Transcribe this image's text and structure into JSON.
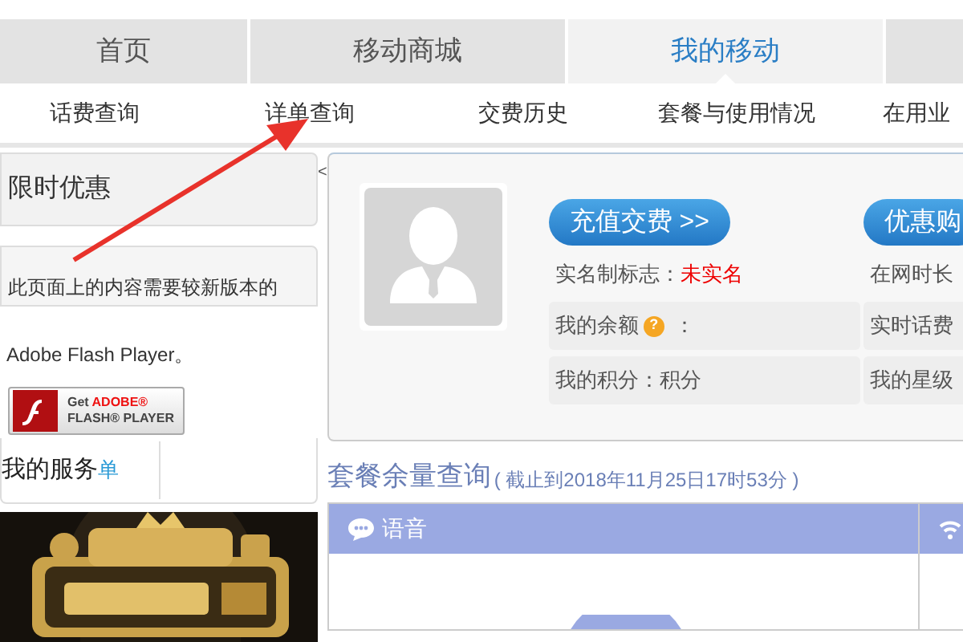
{
  "tabs": [
    {
      "label": "首页",
      "selected": false
    },
    {
      "label": "移动商城",
      "selected": false
    },
    {
      "label": "我的移动",
      "selected": true
    },
    {
      "selected": false
    }
  ],
  "subnav": [
    "话费查询",
    "详单查询",
    "交费历史",
    "套餐与使用情况",
    "在用业"
  ],
  "sidebar": {
    "promo_title": "限时优惠",
    "flash_notice": "此页面上的内容需要较新版本的",
    "flash_name": "Adobe Flash Player。",
    "flash_button": {
      "line1_prefix": "Get ",
      "line1_brand": "ADOBE®",
      "line2": "FLASH® PLAYER"
    },
    "service_title": "我的服务",
    "service_overlap": "单",
    "collapse": "<"
  },
  "account": {
    "buttons": [
      "充值交费 >>",
      "优惠购"
    ],
    "left": [
      {
        "kind": "plain",
        "label": "实名制标志：",
        "value": "未实名"
      },
      {
        "kind": "help",
        "label": "我的余额",
        "help_mark": "?",
        "value": "："
      },
      {
        "kind": "shaded",
        "label": "我的积分：积分"
      }
    ],
    "right": [
      {
        "kind": "plain",
        "label": "在网时长"
      },
      {
        "kind": "help",
        "label": "实时话费"
      },
      {
        "kind": "shaded",
        "label": "我的星级"
      }
    ]
  },
  "package": {
    "title": "套餐余量查询",
    "note": "( 截止到2018年11月25日17时53分 )",
    "sections": [
      {
        "kind": "voice",
        "label": "语音"
      },
      {
        "kind": "data"
      }
    ]
  },
  "annotation": {
    "kind": "arrow",
    "color": "#e8322b"
  }
}
